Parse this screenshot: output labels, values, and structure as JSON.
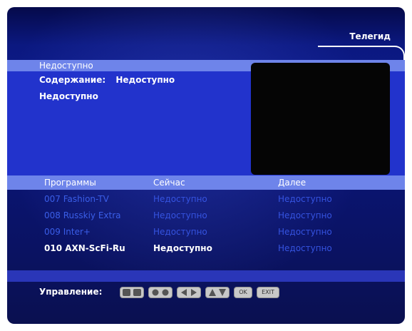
{
  "header": {
    "title": "Телегид"
  },
  "info": {
    "name": "Недоступно",
    "content_label": "Содержание:",
    "content_value": "Недоступно",
    "line3": "Недоступно"
  },
  "list": {
    "columns": [
      "Программы",
      "Сейчас",
      "Далее"
    ],
    "rows": [
      {
        "program": "007 Fashion-TV",
        "now": "Недоступно",
        "next": "Недоступно"
      },
      {
        "program": "008 Russkiy Extra",
        "now": "Недоступно",
        "next": "Недоступно"
      },
      {
        "program": "009 Inter+",
        "now": "Недоступно",
        "next": "Недоступно"
      },
      {
        "program": "010 AXN-ScFi-Ru",
        "now": "Недоступно",
        "next": "Недоступно"
      }
    ]
  },
  "footer": {
    "controls_label": "Управление:",
    "keys": [
      {
        "icon": "page-up-down-icon"
      },
      {
        "icon": "number-keys-icon"
      },
      {
        "icon": "left-right-arrows-icon"
      },
      {
        "icon": "up-down-arrows-icon"
      },
      {
        "label": "OK"
      },
      {
        "label": "EXIT"
      }
    ]
  }
}
